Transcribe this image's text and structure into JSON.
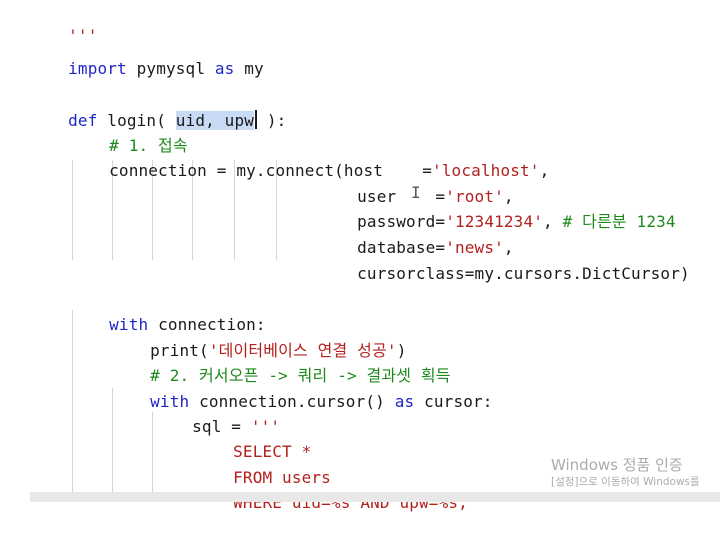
{
  "editor": {
    "lines": {
      "l0": {
        "text": "'''"
      },
      "l1": {
        "kw1": "import",
        "mid": " pymysql ",
        "kw2": "as",
        "end": " my"
      },
      "l2": {
        "kw": "def",
        "pre": " login( ",
        "sel": "uid, upw",
        "post": " ):"
      },
      "l3": {
        "comment": "# 1. 접속"
      },
      "l4": {
        "pre": "connection = my.connect(host    =",
        "str": "'localhost'",
        "post": ","
      },
      "l5": {
        "pre": "user    =",
        "str": "'root'",
        "post": ","
      },
      "l6": {
        "pre": "password=",
        "str": "'12341234'",
        "mid": ", ",
        "comment": "# 다른분 1234"
      },
      "l7": {
        "pre": "database=",
        "str": "'news'",
        "post": ","
      },
      "l8": {
        "text": "cursorclass=my.cursors.DictCursor)"
      },
      "l9": {
        "kw": "with",
        "post": " connection:"
      },
      "l10": {
        "pre": "print(",
        "str": "'데이터베이스 연결 성공'",
        "post": ")"
      },
      "l11": {
        "comment": "# 2. 커서오픈 -> 쿼리 -> 결과셋 획득"
      },
      "l12": {
        "kw": "with",
        "mid": " connection.cursor() ",
        "kw2": "as",
        "post": " cursor:"
      },
      "l13": {
        "pre": "sql = ",
        "str": "'''"
      },
      "l14": {
        "str": "SELECT *"
      },
      "l15": {
        "str": "FROM users"
      },
      "l16": {
        "str": "WHERE uid=%s AND upw=%s;"
      },
      "l17": {
        "str": "'''"
      }
    },
    "colors": {
      "keyword": "#1f26c9",
      "comment": "#1e8a1e",
      "string": "#b3211f",
      "selection": "#c9dbf4"
    }
  },
  "watermark": {
    "title": "Windows 정품 인증",
    "subtitle": "[설정]으로 이동하여 Windows를"
  }
}
